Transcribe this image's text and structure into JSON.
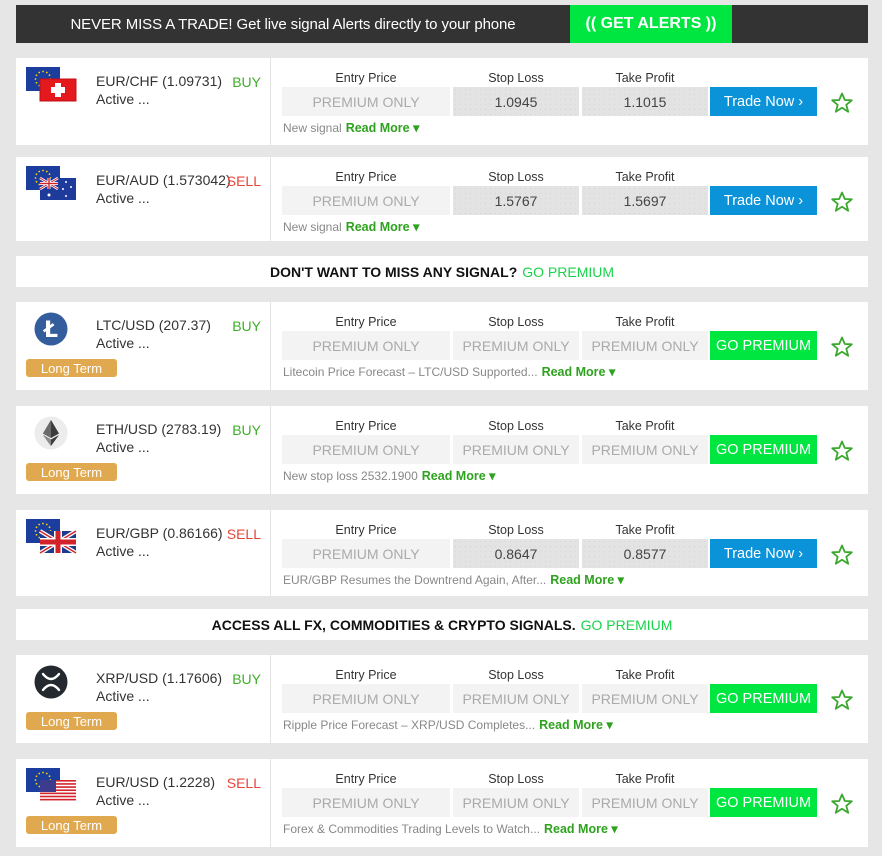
{
  "banner": {
    "text": "NEVER MISS A TRADE! Get live signal Alerts directly to your phone",
    "button": "(( GET ALERTS ))"
  },
  "columns": {
    "entry": "Entry Price",
    "stop": "Stop Loss",
    "take": "Take Profit"
  },
  "read_more": "Read More ▾",
  "status_text": "Active ...",
  "term_label": "Long Term",
  "promos": [
    {
      "text": "DON'T WANT TO MISS ANY SIGNAL?",
      "link": "GO PREMIUM"
    },
    {
      "text": "ACCESS ALL FX, COMMODITIES & CRYPTO SIGNALS.",
      "link": "GO PREMIUM"
    }
  ],
  "signals": [
    {
      "pair": "EUR/CHF (1.09731)",
      "direction": "BUY",
      "icon": "eur-chf-flag-icon",
      "entry": "PREMIUM ONLY",
      "stop": "1.0945",
      "take": "1.1015",
      "action": "Trade Now ›",
      "note": "New signal",
      "long_term": false
    },
    {
      "pair": "EUR/AUD (1.573042)",
      "direction": "SELL",
      "icon": "eur-aud-flag-icon",
      "entry": "PREMIUM ONLY",
      "stop": "1.5767",
      "take": "1.5697",
      "action": "Trade Now ›",
      "note": "New signal",
      "long_term": false
    },
    {
      "pair": "LTC/USD (207.37)",
      "direction": "BUY",
      "icon": "litecoin-icon",
      "entry": "PREMIUM ONLY",
      "stop": "PREMIUM ONLY",
      "take": "PREMIUM ONLY",
      "action": "GO PREMIUM",
      "note": "Litecoin Price Forecast – LTC/USD Supported...",
      "long_term": true
    },
    {
      "pair": "ETH/USD (2783.19)",
      "direction": "BUY",
      "icon": "ethereum-icon",
      "entry": "PREMIUM ONLY",
      "stop": "PREMIUM ONLY",
      "take": "PREMIUM ONLY",
      "action": "GO PREMIUM",
      "note": "New stop loss 2532.1900",
      "long_term": true
    },
    {
      "pair": "EUR/GBP (0.86166)",
      "direction": "SELL",
      "icon": "eur-gbp-flag-icon",
      "entry": "PREMIUM ONLY",
      "stop": "0.8647",
      "take": "0.8577",
      "action": "Trade Now ›",
      "note": "EUR/GBP Resumes the Downtrend Again, After...",
      "long_term": false
    },
    {
      "pair": "XRP/USD (1.17606)",
      "direction": "BUY",
      "icon": "ripple-icon",
      "entry": "PREMIUM ONLY",
      "stop": "PREMIUM ONLY",
      "take": "PREMIUM ONLY",
      "action": "GO PREMIUM",
      "note": "Ripple Price Forecast – XRP/USD Completes...",
      "long_term": true
    },
    {
      "pair": "EUR/USD (1.2228)",
      "direction": "SELL",
      "icon": "eur-usd-flag-icon",
      "entry": "PREMIUM ONLY",
      "stop": "PREMIUM ONLY",
      "take": "PREMIUM ONLY",
      "action": "GO PREMIUM",
      "note": "Forex & Commodities Trading Levels to Watch...",
      "long_term": true
    }
  ],
  "colors": {
    "buy": "#3fae2a",
    "sell": "#e8453c",
    "trade_button": "#0a93d9",
    "premium_button": "#00e640",
    "long_term": "#e0a84f"
  }
}
